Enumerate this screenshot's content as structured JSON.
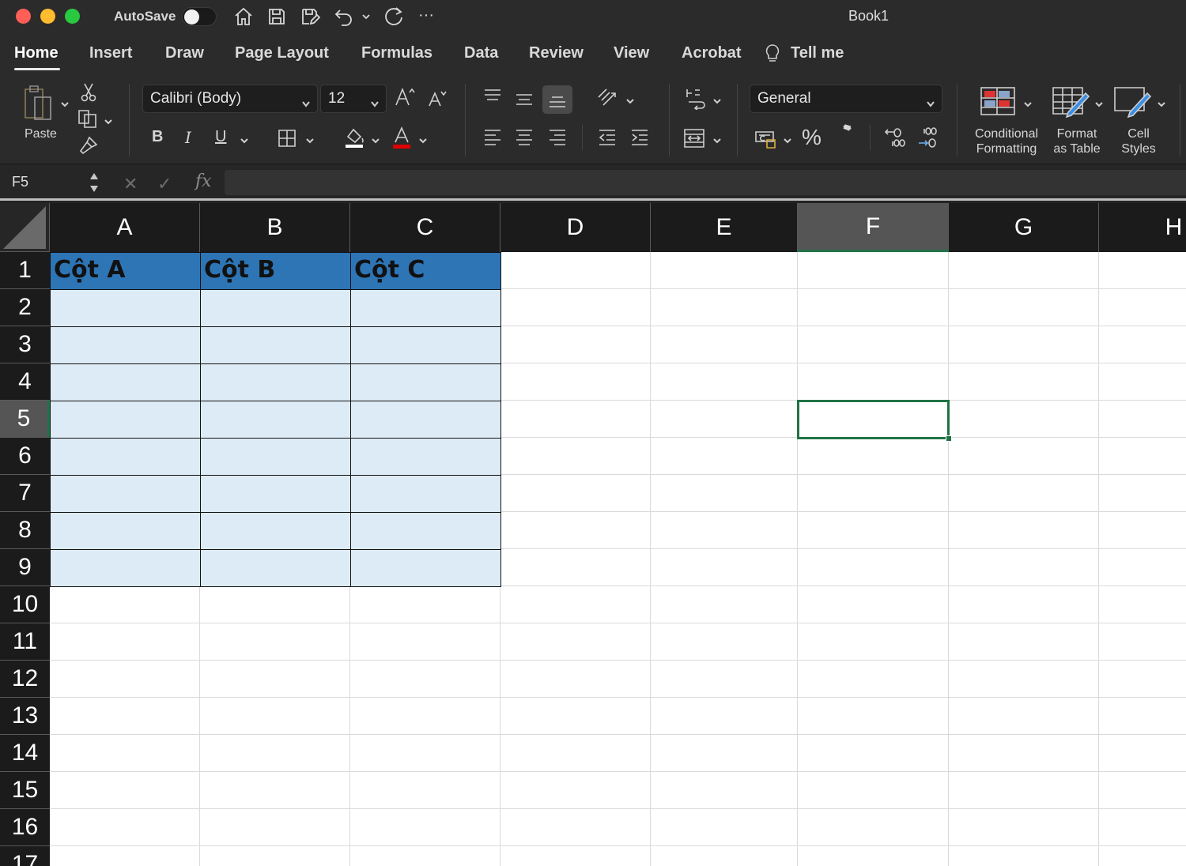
{
  "titlebar": {
    "autosave_label": "AutoSave",
    "autosave_on": false,
    "more": "···",
    "document_title": "Book1"
  },
  "tabs": [
    "Home",
    "Insert",
    "Draw",
    "Page Layout",
    "Formulas",
    "Data",
    "Review",
    "View",
    "Acrobat",
    "Tell me"
  ],
  "active_tab": "Home",
  "ribbon": {
    "paste_label": "Paste",
    "font_name": "Calibri (Body)",
    "font_size": "12",
    "bold": "B",
    "italic": "I",
    "underline": "U",
    "number_format": "General",
    "percent": "%",
    "comma": "݉",
    "conditional_formatting": "Conditional\nFormatting",
    "format_as_table": "Format\nas Table",
    "cell_styles": "Cell\nStyles",
    "font_color": "#e00000",
    "fill_color": "#ffffff"
  },
  "formula_bar": {
    "name_box": "F5",
    "fx": "fx",
    "formula": ""
  },
  "sheet": {
    "columns": [
      "A",
      "B",
      "C",
      "D",
      "E",
      "F",
      "G",
      "H"
    ],
    "rows": [
      "1",
      "2",
      "3",
      "4",
      "5",
      "6",
      "7",
      "8",
      "9",
      "10",
      "11",
      "12",
      "13",
      "14",
      "15",
      "16",
      "17"
    ],
    "selected_column": "F",
    "selected_row": "5",
    "cells": {
      "A1": "Cột A",
      "B1": "Cột B",
      "C1": "Cột C"
    },
    "table_header_color": "#2e75b6",
    "table_body_color": "#ddebf7",
    "active_cell_color": "#217346"
  }
}
